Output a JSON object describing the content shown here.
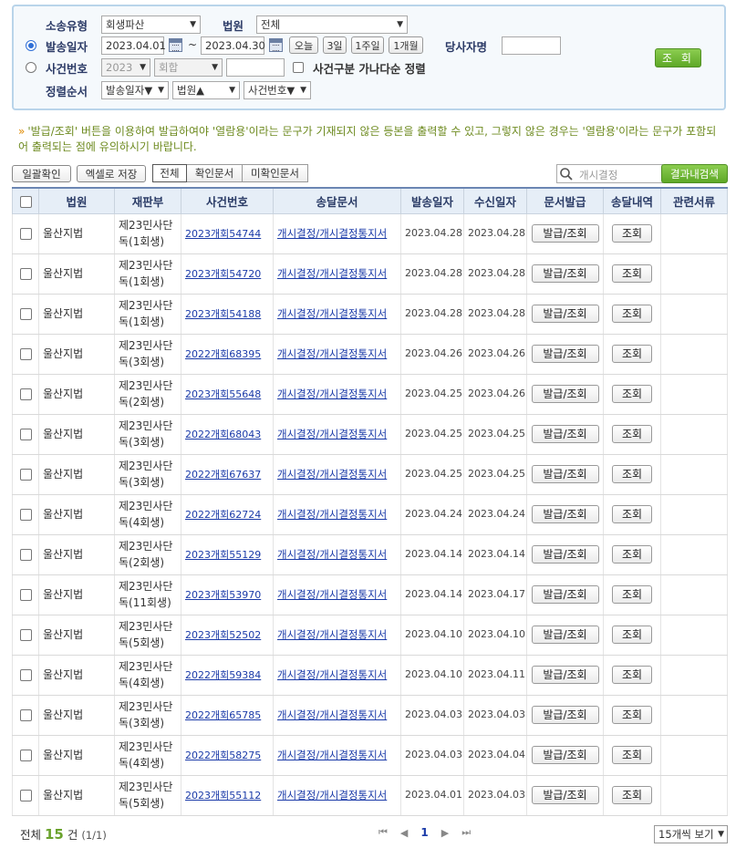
{
  "search": {
    "case_type_label": "소송유형",
    "case_type_value": "회생파산",
    "court_label": "법원",
    "court_value": "전체",
    "send_date_label": "발송일자",
    "date_from": "2023.04.01",
    "date_sep": "~",
    "date_to": "2023.04.30",
    "quick_today": "오늘",
    "quick_3day": "3일",
    "quick_1week": "1주일",
    "quick_1month": "1개월",
    "party_label": "당사자명",
    "party_value": "",
    "case_no_label": "사건번호",
    "case_year": "2023",
    "case_kind": "회합",
    "case_num_value": "",
    "sort_check_label": "사건구분 가나다순 정렬",
    "sort_label": "정렬순서",
    "sort1": "발송일자▼",
    "sort2": "법원▲",
    "sort3": "사건번호▼",
    "search_button": "조 회"
  },
  "notice": {
    "bullet": "»",
    "text": "'발급/조회' 버튼을 이용하여 발급하여야 '열람용'이라는 문구가 기재되지 않은 등본을 출력할 수 있고, 그렇지 않은 경우는 '열람용'이라는 문구가 포함되어 출력되는 점에 유의하시기 바랍니다."
  },
  "toolbar": {
    "bulk_confirm": "일괄확인",
    "excel_save": "엑셀로 저장",
    "filter_all": "전체",
    "filter_confirmed": "확인문서",
    "filter_unconfirmed": "미확인문서",
    "result_search_placeholder": "개시결정",
    "result_search_button": "결과내검색"
  },
  "table": {
    "headers": [
      "",
      "법원",
      "재판부",
      "사건번호",
      "송달문서",
      "발송일자",
      "수신일자",
      "문서발급",
      "송달내역",
      "관련서류"
    ],
    "issue_label": "발급/조회",
    "view_label": "조회",
    "rows": [
      {
        "court": "울산지법",
        "dept": "제23민사단독(1회생)",
        "case": "2023개회54744",
        "doc": "개시결정/개시결정통지서",
        "sent": "2023.04.28",
        "recv": "2023.04.28"
      },
      {
        "court": "울산지법",
        "dept": "제23민사단독(1회생)",
        "case": "2023개회54720",
        "doc": "개시결정/개시결정통지서",
        "sent": "2023.04.28",
        "recv": "2023.04.28"
      },
      {
        "court": "울산지법",
        "dept": "제23민사단독(1회생)",
        "case": "2023개회54188",
        "doc": "개시결정/개시결정통지서",
        "sent": "2023.04.28",
        "recv": "2023.04.28"
      },
      {
        "court": "울산지법",
        "dept": "제23민사단독(3회생)",
        "case": "2022개회68395",
        "doc": "개시결정/개시결정통지서",
        "sent": "2023.04.26",
        "recv": "2023.04.26"
      },
      {
        "court": "울산지법",
        "dept": "제23민사단독(2회생)",
        "case": "2023개회55648",
        "doc": "개시결정/개시결정통지서",
        "sent": "2023.04.25",
        "recv": "2023.04.26"
      },
      {
        "court": "울산지법",
        "dept": "제23민사단독(3회생)",
        "case": "2022개회68043",
        "doc": "개시결정/개시결정통지서",
        "sent": "2023.04.25",
        "recv": "2023.04.25"
      },
      {
        "court": "울산지법",
        "dept": "제23민사단독(3회생)",
        "case": "2022개회67637",
        "doc": "개시결정/개시결정통지서",
        "sent": "2023.04.25",
        "recv": "2023.04.25"
      },
      {
        "court": "울산지법",
        "dept": "제23민사단독(4회생)",
        "case": "2022개회62724",
        "doc": "개시결정/개시결정통지서",
        "sent": "2023.04.24",
        "recv": "2023.04.24"
      },
      {
        "court": "울산지법",
        "dept": "제23민사단독(2회생)",
        "case": "2023개회55129",
        "doc": "개시결정/개시결정통지서",
        "sent": "2023.04.14",
        "recv": "2023.04.14"
      },
      {
        "court": "울산지법",
        "dept": "제23민사단독(11회생)",
        "case": "2023개회53970",
        "doc": "개시결정/개시결정통지서",
        "sent": "2023.04.14",
        "recv": "2023.04.17"
      },
      {
        "court": "울산지법",
        "dept": "제23민사단독(5회생)",
        "case": "2023개회52502",
        "doc": "개시결정/개시결정통지서",
        "sent": "2023.04.10",
        "recv": "2023.04.10"
      },
      {
        "court": "울산지법",
        "dept": "제23민사단독(4회생)",
        "case": "2022개회59384",
        "doc": "개시결정/개시결정통지서",
        "sent": "2023.04.10",
        "recv": "2023.04.11"
      },
      {
        "court": "울산지법",
        "dept": "제23민사단독(3회생)",
        "case": "2022개회65785",
        "doc": "개시결정/개시결정통지서",
        "sent": "2023.04.03",
        "recv": "2023.04.03"
      },
      {
        "court": "울산지법",
        "dept": "제23민사단독(4회생)",
        "case": "2022개회58275",
        "doc": "개시결정/개시결정통지서",
        "sent": "2023.04.03",
        "recv": "2023.04.04"
      },
      {
        "court": "울산지법",
        "dept": "제23민사단독(5회생)",
        "case": "2023개회55112",
        "doc": "개시결정/개시결정통지서",
        "sent": "2023.04.01",
        "recv": "2023.04.03"
      }
    ]
  },
  "footer": {
    "total_prefix": "전체",
    "total_count": "15",
    "total_unit": "건",
    "page_info": "(1/1)",
    "current_page": "1",
    "page_size": "15개씩 보기"
  }
}
